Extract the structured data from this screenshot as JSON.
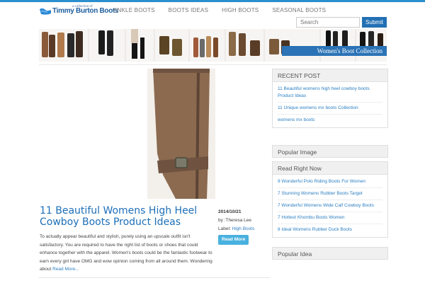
{
  "brand": {
    "tagline": "a collection of",
    "name": "Timmy Burton Boots",
    "accent": "#2a8fce",
    "title_blue": "#1d6fb8"
  },
  "nav": {
    "items": [
      {
        "label": "ANKLE BOOTS"
      },
      {
        "label": "BOOTS IDEAS"
      },
      {
        "label": "HIGH BOOTS"
      },
      {
        "label": "SEASONAL BOOTS"
      }
    ]
  },
  "search": {
    "placeholder": "Search",
    "button_label": "Submit"
  },
  "banner": {
    "label": "Women's Boot Collection"
  },
  "post": {
    "title": "11 Beautiful Womens High Heel Cowboy Boots Product Ideas",
    "date": "2014/10/21",
    "author": "by :Theresa Lee",
    "label_prefix": "Label:",
    "label_value": "High Boots",
    "more_label": "Read More",
    "excerpt": "To actually appear beautiful and stylish, purely using an upscale outfit isn't satisfactory. You are required to have the right list of boots or shoes that could enhance together with the apparel. Women's boots could be the fantastic footwear to earn every girl have OMG and wow opinion coming from all around them. Wondering about",
    "read_more": "Read More..."
  },
  "sidebar": {
    "recent": {
      "title": "RECENT POST",
      "items": [
        {
          "label": "11 Beautiful womens high heel cowboy boots Product Ideas"
        },
        {
          "label": "11 Unique womens mx boots Collection"
        },
        {
          "label": "womens mx boots"
        }
      ]
    },
    "popular_image": {
      "title": "Popular Image"
    },
    "read_right_now": {
      "title": "Read Right Now",
      "items": [
        {
          "label": "9 Wonderful Polo Riding Boots For Women"
        },
        {
          "label": "7 Stunning Womens Rubber Boots Target"
        },
        {
          "label": "7 Wonderful Womens Wide Calf Cowboy Boots"
        },
        {
          "label": "7 Hottest Khombu Boots Women"
        },
        {
          "label": "8 Ideal Womens Rubber Duck Boots"
        }
      ]
    },
    "popular_idea": {
      "title": "Popular Idea"
    }
  }
}
